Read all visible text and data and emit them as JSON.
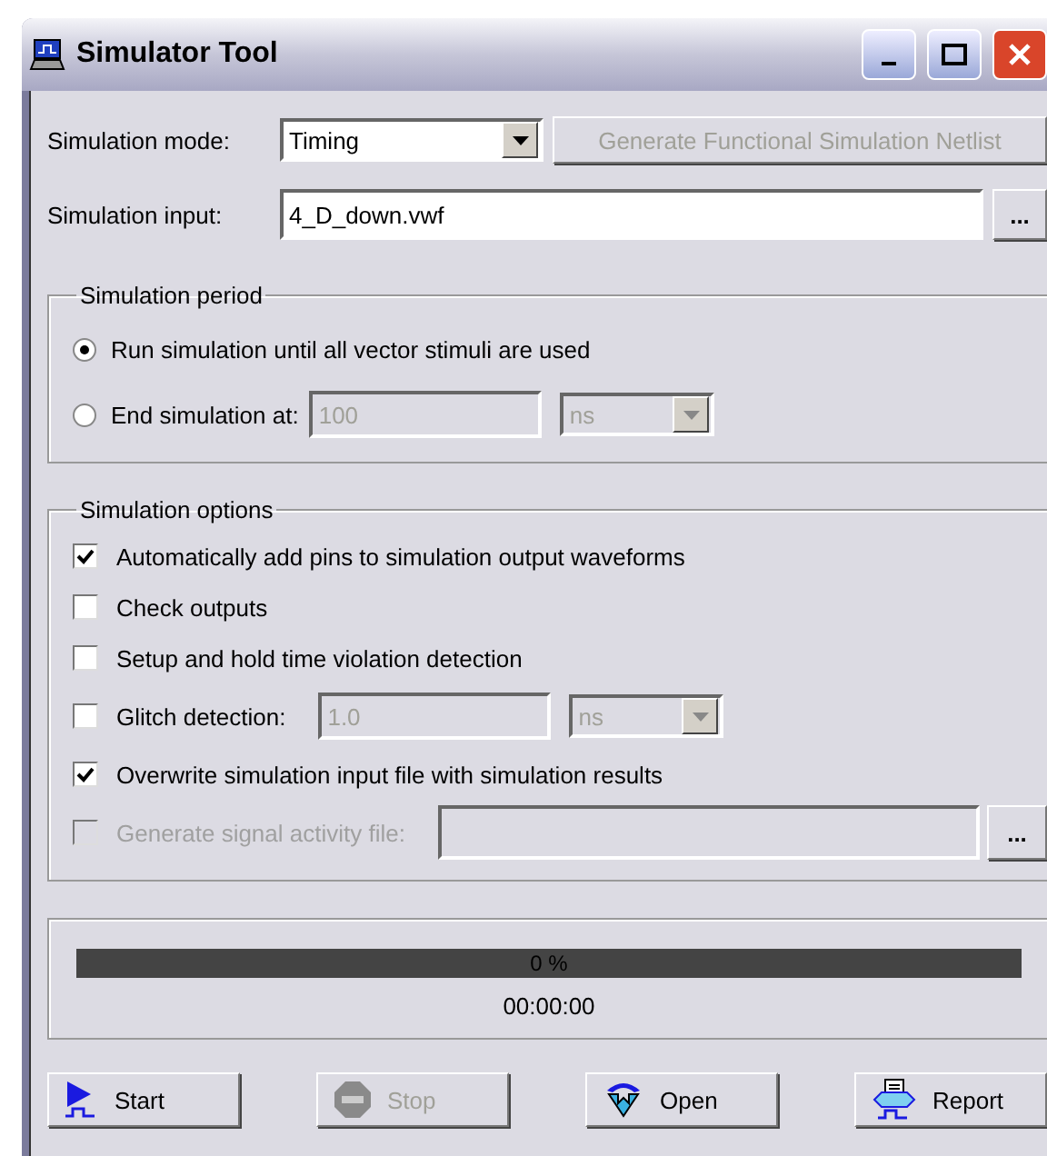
{
  "window": {
    "title": "Simulator Tool"
  },
  "mode": {
    "label": "Simulation mode:",
    "value": "Timing"
  },
  "generate_button": {
    "label": "Generate Functional Simulation Netlist",
    "disabled": true
  },
  "input": {
    "label": "Simulation input:",
    "value": "4_D_down.vwf",
    "browse": "..."
  },
  "period": {
    "title": "Simulation period",
    "options": [
      {
        "kind": "plain",
        "label": "Run simulation until all vector stimuli are used",
        "selected": true
      },
      {
        "kind": "time",
        "label": "End simulation at:",
        "selected": false,
        "value": "100",
        "unit": "ns"
      }
    ]
  },
  "options": {
    "title": "Simulation options",
    "items": [
      {
        "kind": "plain",
        "label": "Automatically add pins to simulation output waveforms",
        "checked": true,
        "disabled": false
      },
      {
        "kind": "plain",
        "label": "Check outputs",
        "checked": false,
        "disabled": false
      },
      {
        "kind": "plain",
        "label": "Setup and hold time violation detection",
        "checked": false,
        "disabled": false
      },
      {
        "kind": "time",
        "label": "Glitch detection:",
        "checked": false,
        "disabled": false,
        "value": "1.0",
        "unit": "ns"
      },
      {
        "kind": "plain",
        "label": "Overwrite simulation input file with simulation results",
        "checked": true,
        "disabled": false
      },
      {
        "kind": "file",
        "label": "Generate signal activity file:",
        "checked": false,
        "disabled": true,
        "browse": "..."
      }
    ]
  },
  "progress": {
    "level": 0,
    "percent": "0 %",
    "elapsed": "00:00:00"
  },
  "buttons": [
    {
      "kind": "start",
      "label": "Start",
      "disabled": false
    },
    {
      "kind": "stop",
      "label": "Stop",
      "disabled": true
    },
    {
      "kind": "open",
      "label": "Open",
      "disabled": false
    },
    {
      "kind": "report",
      "label": "Report",
      "disabled": false
    }
  ]
}
